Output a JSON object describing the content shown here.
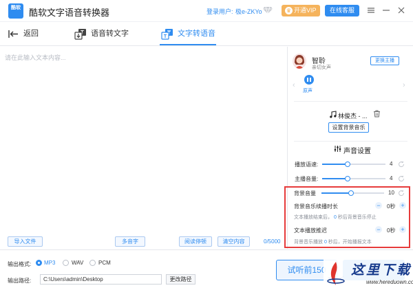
{
  "window": {
    "logo_text": "酷软",
    "title": "酷软文字语音转换器",
    "login_label": "登录用户:",
    "login_user": "极e-ZKYo",
    "vip_label": "开通VIP",
    "service_label": "在线客服"
  },
  "tabs": {
    "back": "返回",
    "speech_to_text": "语音转文字",
    "text_to_speech": "文字转语音"
  },
  "editor": {
    "placeholder": "请在此输入文本内容...",
    "import_label": "导入文件",
    "multi_voice_label": "多音字",
    "pause_label": "阅读停顿",
    "clear_label": "清空内容",
    "char_count": "0/5000"
  },
  "voice": {
    "name": "智聆",
    "description": "亲切女声",
    "change_label": "更换主播",
    "original_label": "原声"
  },
  "music": {
    "name": "林俊杰 - ...",
    "set_bgm_label": "设置背景音乐"
  },
  "settings": {
    "title": "声音设置",
    "speed": {
      "label": "播放语速:",
      "value": "4",
      "level": 0.4
    },
    "volume": {
      "label": "主播音量:",
      "value": "4",
      "level": 0.4
    },
    "bg_volume": {
      "label": "背景音量",
      "value": "10",
      "level": 0.47
    },
    "bg_duration": {
      "label": "背景音乐续播时长",
      "value": "0秒",
      "hint_prefix": "文本播放结束后，",
      "hint_value": "0",
      "hint_suffix": "秒后背景音乐停止"
    },
    "text_delay": {
      "label": "文本播放推迟",
      "value": "0秒",
      "hint_prefix": "背景音乐播放",
      "hint_value": "0",
      "hint_suffix": "秒后，开始播报文本"
    }
  },
  "output": {
    "format_label": "输出格式:",
    "formats": [
      "MP3",
      "WAV",
      "PCM"
    ],
    "selected_format": "MP3",
    "path_label": "输出路径:",
    "path_value": "C:\\Users\\admin\\Desktop",
    "change_path_label": "更改路径",
    "preview_label": "试听前150"
  },
  "watermark": {
    "text": "这里下载",
    "url": "www.hereduown.com"
  },
  "colors": {
    "accent": "#2f8cf0",
    "vip": "#f5b35c",
    "highlight_box": "#e63a3a"
  }
}
